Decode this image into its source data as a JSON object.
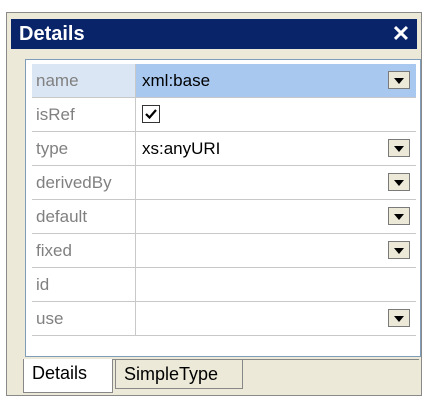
{
  "window": {
    "title": "Details",
    "close_label": "✕"
  },
  "rows": [
    {
      "name": "name",
      "value": "xml:base",
      "selected": true,
      "dropdown": true
    },
    {
      "name": "isRef",
      "checkbox": true,
      "checked": true
    },
    {
      "name": "type",
      "value": "xs:anyURI",
      "dropdown": true
    },
    {
      "name": "derivedBy",
      "value": "",
      "dropdown": true
    },
    {
      "name": "default",
      "value": "",
      "dropdown": true
    },
    {
      "name": "fixed",
      "value": "",
      "dropdown": true
    },
    {
      "name": "id",
      "value": ""
    },
    {
      "name": "use",
      "value": "",
      "dropdown": true
    }
  ],
  "tabs": [
    {
      "label": "Details",
      "active": true
    },
    {
      "label": "SimpleType",
      "active": false
    }
  ]
}
